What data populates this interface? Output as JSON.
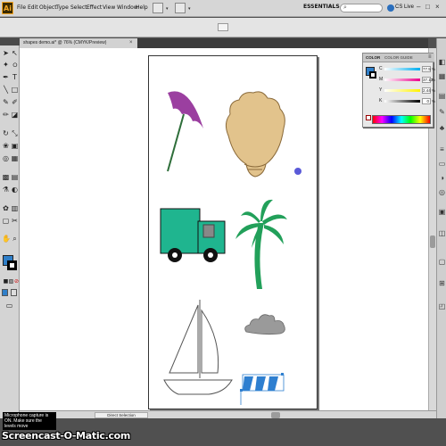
{
  "app": {
    "logo": "Ai"
  },
  "menubar": {
    "items": [
      "File",
      "Edit",
      "Object",
      "Type",
      "Select",
      "Effect",
      "View",
      "Window",
      "Help"
    ],
    "workspace": "ESSENTIALS",
    "cs_live": "CS Live",
    "window_controls": [
      "–",
      "□",
      "×"
    ]
  },
  "document": {
    "tab_title": "shapes demo.ai* @ 76% (CMYK/Preview)",
    "close": "×"
  },
  "tools_panel": {
    "fill_color": "#2f7fc9",
    "stroke_color": "#000000"
  },
  "color_panel": {
    "tabs": [
      "COLOR",
      "COLOR GUIDE"
    ],
    "menu": "≡",
    "channels": [
      {
        "label": "C",
        "value": "77.5",
        "unit": "%",
        "gradient": "linear-gradient(to right,#fff,#00aeef)"
      },
      {
        "label": "M",
        "value": "37.13",
        "unit": "%",
        "gradient": "linear-gradient(to right,#fff,#ec008c)"
      },
      {
        "label": "Y",
        "value": "2.44",
        "unit": "%",
        "gradient": "linear-gradient(to right,#fff,#fff200)"
      },
      {
        "label": "K",
        "value": "0",
        "unit": "%",
        "gradient": "linear-gradient(to right,#fff,#000)"
      }
    ]
  },
  "statusbar": {
    "tool": "Direct Selection"
  },
  "overlay": {
    "mic_note": "Microphone capture is ON. Make sure the levels move",
    "watermark": "Screencast-O-Matic.com"
  },
  "colors": {
    "umbrella": "#9b3fa0",
    "umbrella_handle": "#2e6e3a",
    "shell": "#e2c38c",
    "truck": "#1fb58f",
    "palm": "#22a05a",
    "cloud": "#9a9a9a",
    "canopy_stripe": "#2e7fd0"
  }
}
